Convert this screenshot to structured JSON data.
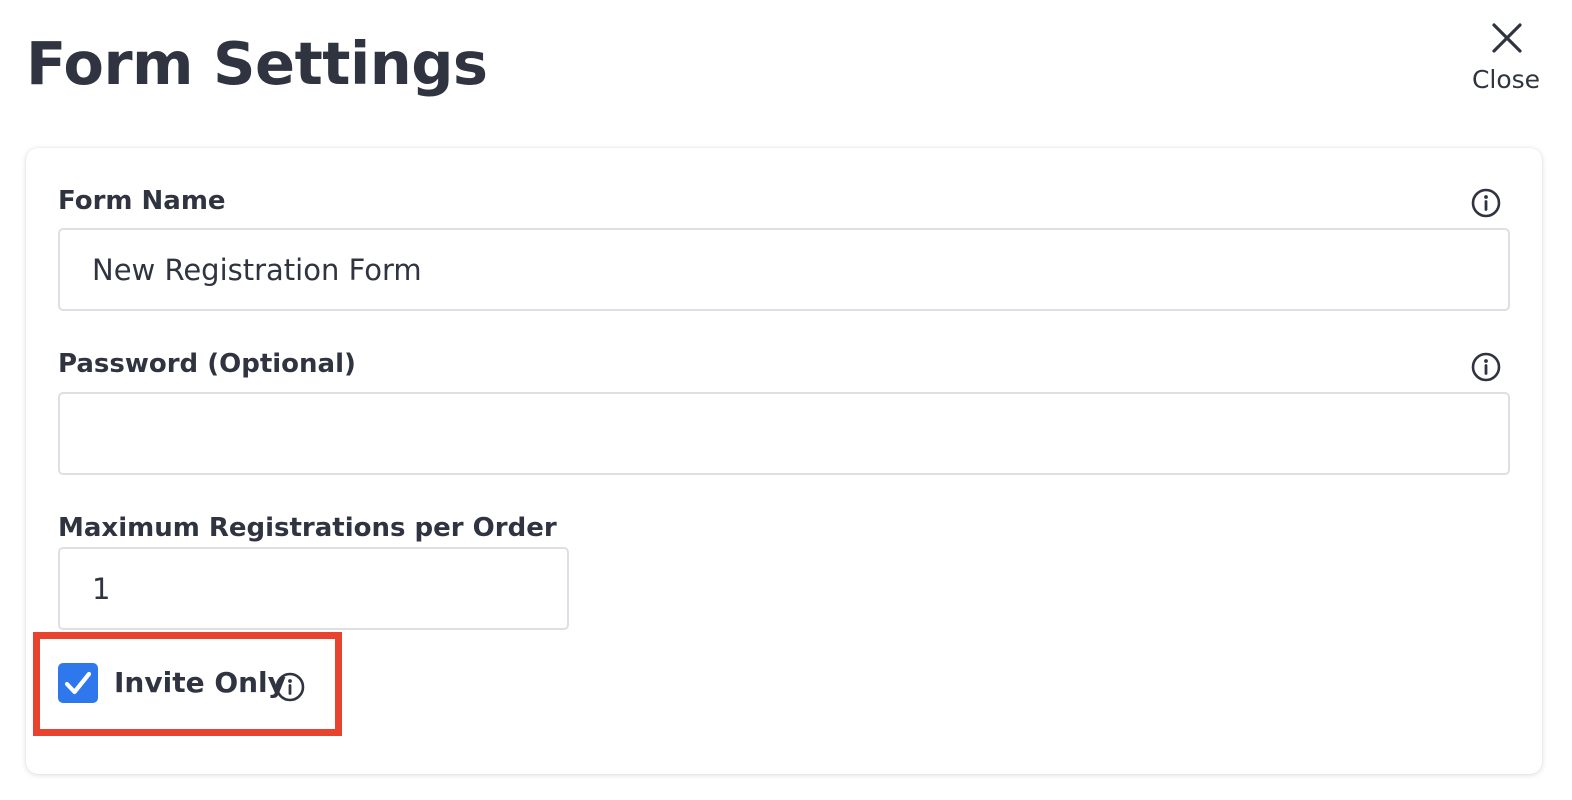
{
  "header": {
    "title": "Form Settings",
    "close_label": "Close",
    "close_icon": "close-icon"
  },
  "form": {
    "form_name": {
      "label": "Form Name",
      "value": "New Registration Form",
      "info_icon": "info-icon"
    },
    "password": {
      "label": "Password (Optional)",
      "value": "",
      "info_icon": "info-icon"
    },
    "max_registrations": {
      "label": "Maximum Registrations per Order",
      "value": "1"
    },
    "invite_only": {
      "label": "Invite Only",
      "checked": true,
      "info_icon": "info-icon"
    }
  },
  "colors": {
    "text": "#2f3440",
    "checkbox": "#2f77ec",
    "highlight": "#e8432e",
    "input_border": "#dcdfe4"
  }
}
